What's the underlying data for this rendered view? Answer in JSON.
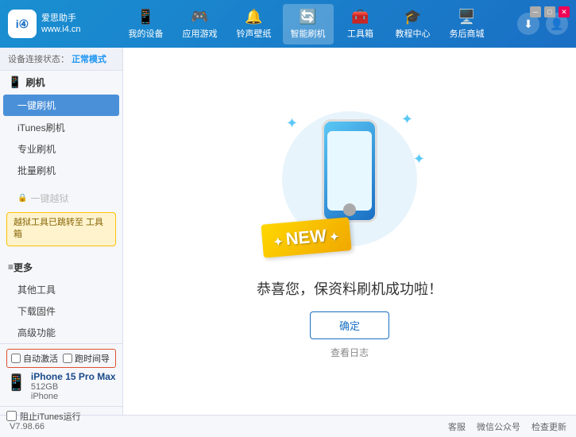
{
  "app": {
    "logo_text_line1": "爱思助手",
    "logo_text_line2": "www.i4.cn",
    "logo_abbr": "i④"
  },
  "nav": {
    "tabs": [
      {
        "id": "my-device",
        "icon": "📱",
        "label": "我的设备"
      },
      {
        "id": "app-game",
        "icon": "🕹️",
        "label": "应用游戏"
      },
      {
        "id": "ringtone",
        "icon": "🎵",
        "label": "铃声壁纸"
      },
      {
        "id": "smart-flash",
        "icon": "🔄",
        "label": "智能刷机",
        "active": true
      },
      {
        "id": "toolbox",
        "icon": "🧰",
        "label": "工具箱"
      },
      {
        "id": "tutorial",
        "icon": "🎓",
        "label": "教程中心"
      },
      {
        "id": "service",
        "icon": "🖥️",
        "label": "务后商城"
      }
    ]
  },
  "win_controls": {
    "min": "─",
    "max": "□",
    "close": "✕"
  },
  "sidebar": {
    "status_label": "设备连接状态：",
    "status_value": "正常模式",
    "section_flash": "刷机",
    "items": [
      {
        "id": "one-key-flash",
        "label": "一键刷机",
        "active": true
      },
      {
        "id": "itunes-flash",
        "label": "iTunes刷机"
      },
      {
        "id": "pro-flash",
        "label": "专业刷机"
      },
      {
        "id": "batch-flash",
        "label": "批量刷机"
      }
    ],
    "section_jailbreak": "一键越狱",
    "jailbreak_disabled_label": "一键越狱",
    "warning_text": "越狱工具已跳转至\n工具箱",
    "section_more": "更多",
    "more_items": [
      {
        "id": "other-tools",
        "label": "其他工具"
      },
      {
        "id": "download-firmware",
        "label": "下载固件"
      },
      {
        "id": "advanced",
        "label": "高级功能"
      }
    ],
    "auto_activate": "自动激活",
    "time_guided": "跑时间导",
    "device_name": "iPhone 15 Pro Max",
    "device_storage": "512GB",
    "device_type": "iPhone",
    "itunes_label": "阻止iTunes运行"
  },
  "content": {
    "new_badge": "NEW",
    "success_message": "恭喜您，保资料刷机成功啦！",
    "confirm_button": "确定",
    "log_link": "查看日志"
  },
  "footer": {
    "version": "V7.98.66",
    "links": [
      "客服",
      "微信公众号",
      "检查更新"
    ]
  }
}
